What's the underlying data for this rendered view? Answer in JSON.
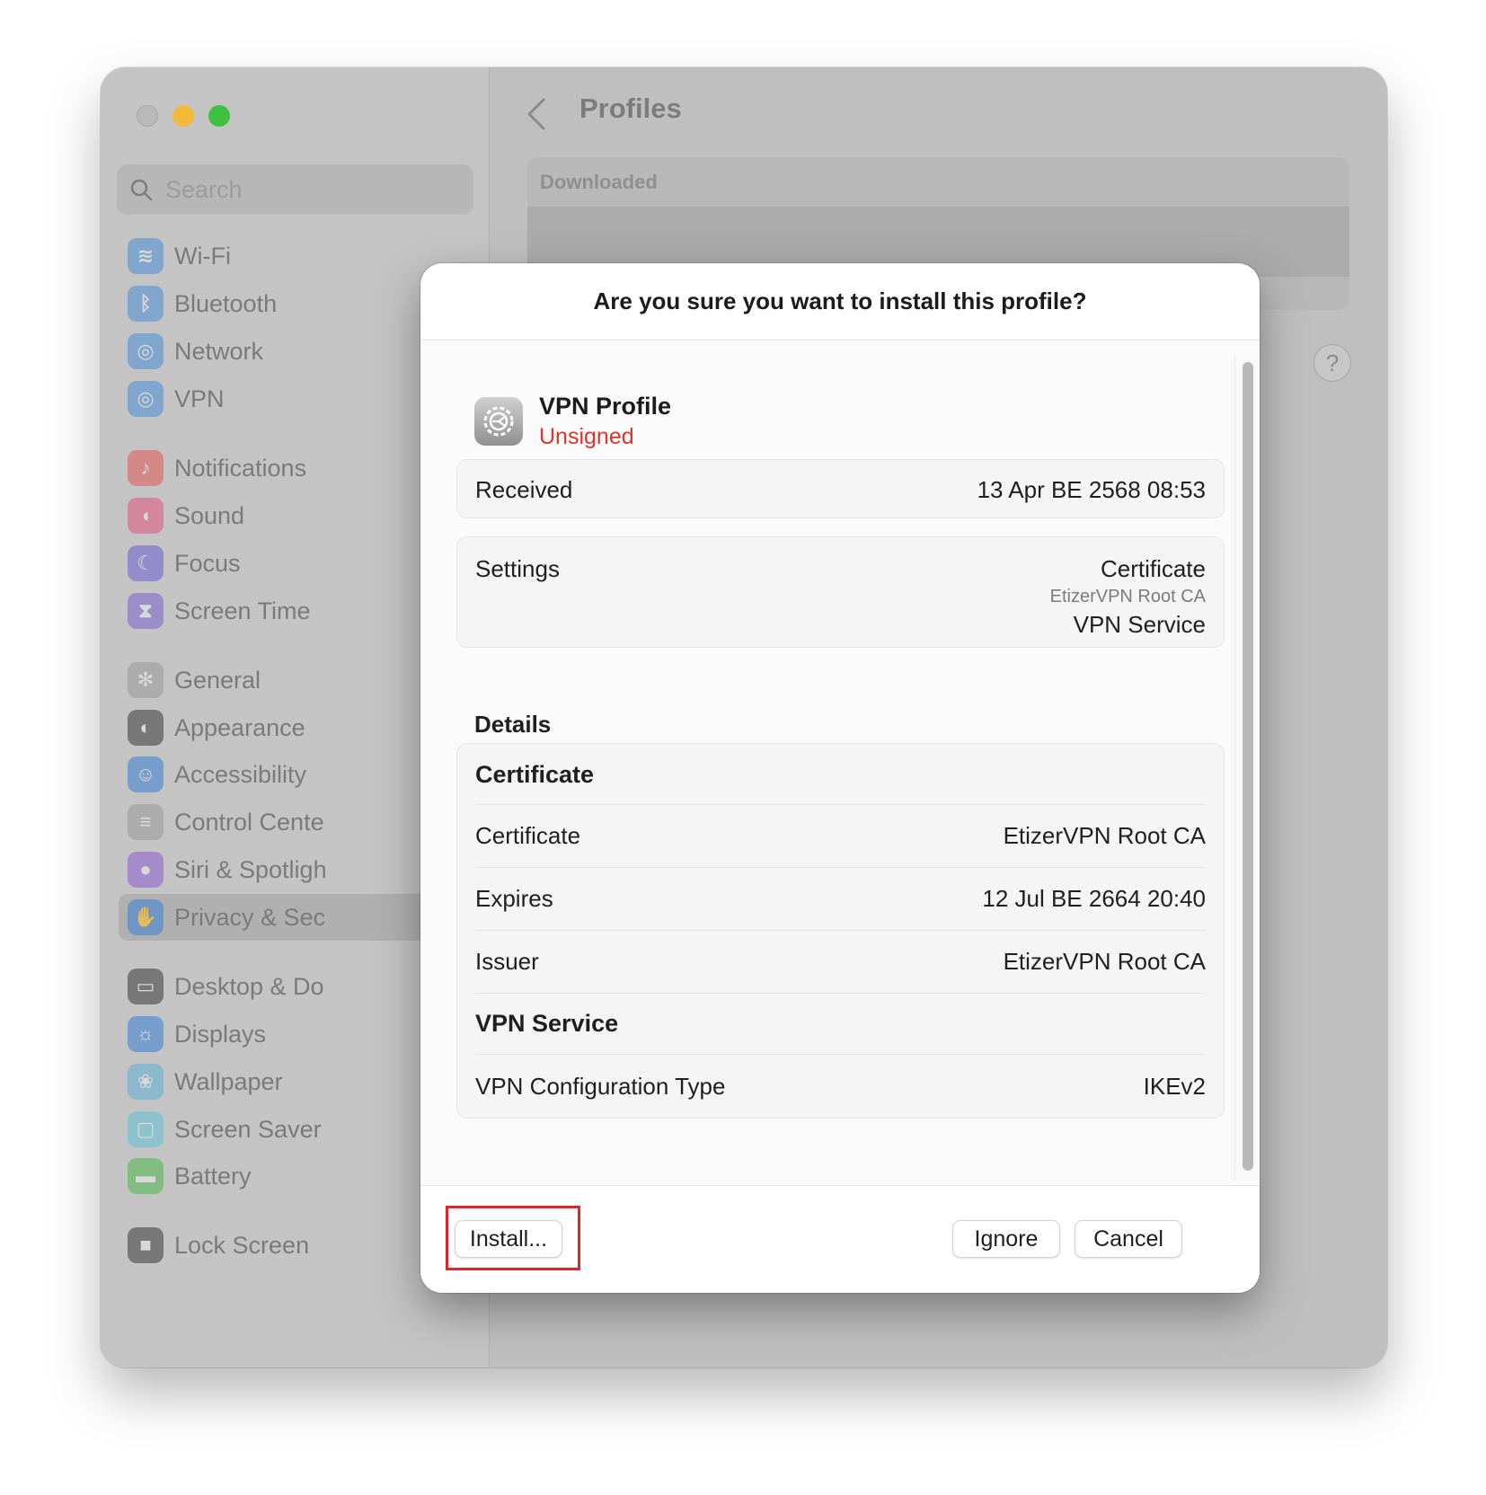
{
  "window": {
    "search": {
      "placeholder": "Search"
    },
    "sidebar": {
      "items": [
        {
          "label": "Wi-Fi",
          "icon": "wifi-icon",
          "color": "#4a8fd6"
        },
        {
          "label": "Bluetooth",
          "icon": "bluetooth-icon",
          "color": "#4a8fd6"
        },
        {
          "label": "Network",
          "icon": "globe-icon",
          "color": "#4a8fd6"
        },
        {
          "label": "VPN",
          "icon": "vpn-globe-icon",
          "color": "#4a8fd6"
        },
        {
          "label": "Notifications",
          "icon": "bell-icon",
          "color": "#e05757"
        },
        {
          "label": "Sound",
          "icon": "speaker-icon",
          "color": "#e05780"
        },
        {
          "label": "Focus",
          "icon": "moon-icon",
          "color": "#6b5fd0"
        },
        {
          "label": "Screen Time",
          "icon": "hourglass-icon",
          "color": "#7b5fd0"
        },
        {
          "label": "General",
          "icon": "gear-icon",
          "color": "#9a9a9a"
        },
        {
          "label": "Appearance",
          "icon": "appearance-icon",
          "color": "#3a3a3a"
        },
        {
          "label": "Accessibility",
          "icon": "accessibility-icon",
          "color": "#3a7fd6"
        },
        {
          "label": "Control Cente",
          "icon": "toggles-icon",
          "color": "#9a9a9a"
        },
        {
          "label": "Siri & Spotligh",
          "icon": "siri-icon",
          "color": "#8a5fd0"
        },
        {
          "label": "Privacy & Sec",
          "icon": "hand-icon",
          "color": "#3a7fd6"
        },
        {
          "label": "Desktop & Do",
          "icon": "desktop-icon",
          "color": "#3a3a3a"
        },
        {
          "label": "Displays",
          "icon": "sun-icon",
          "color": "#3a7fd6"
        },
        {
          "label": "Wallpaper",
          "icon": "flower-icon",
          "color": "#5fb0d6"
        },
        {
          "label": "Screen Saver",
          "icon": "screensaver-icon",
          "color": "#5fc0d6"
        },
        {
          "label": "Battery",
          "icon": "battery-icon",
          "color": "#4cb84c"
        },
        {
          "label": "Lock Screen",
          "icon": "lock-icon",
          "color": "#3a3a3a"
        }
      ]
    },
    "main": {
      "title": "Profiles",
      "section_header": "Downloaded",
      "help_label": "?"
    }
  },
  "dialog": {
    "title": "Are you sure you want to install this profile?",
    "profile": {
      "name": "VPN Profile",
      "status": "Unsigned"
    },
    "received": {
      "label": "Received",
      "value": "13 Apr BE 2568 08:53"
    },
    "settings": {
      "label": "Settings",
      "items": [
        "Certificate",
        "EtizerVPN Root CA",
        "VPN Service"
      ]
    },
    "details": {
      "heading": "Details",
      "certificate_section": "Certificate",
      "rows": [
        {
          "label": "Certificate",
          "value": "EtizerVPN Root CA"
        },
        {
          "label": "Expires",
          "value": "12 Jul BE 2664 20:40"
        },
        {
          "label": "Issuer",
          "value": "EtizerVPN Root CA"
        }
      ],
      "vpn_section": "VPN Service",
      "vpn_row": {
        "label": "VPN Configuration Type",
        "value": "IKEv2"
      }
    },
    "buttons": {
      "install": "Install...",
      "ignore": "Ignore",
      "cancel": "Cancel"
    }
  }
}
